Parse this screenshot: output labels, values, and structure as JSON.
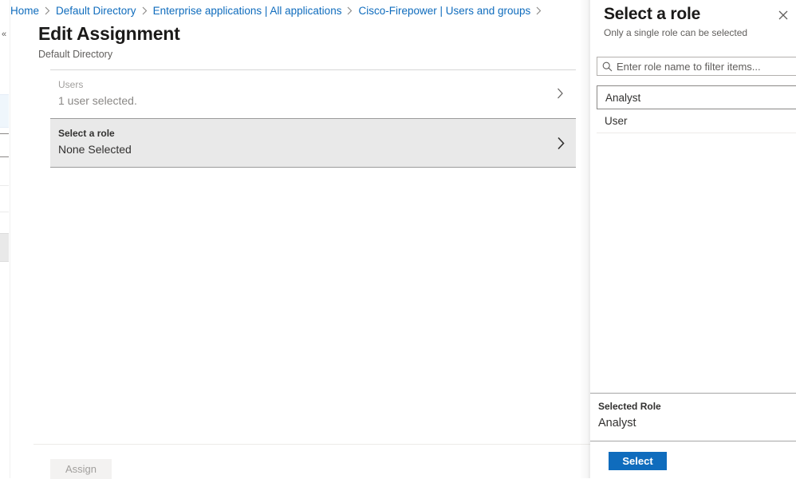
{
  "breadcrumb": {
    "items": [
      {
        "label": "Home"
      },
      {
        "label": "Default Directory"
      },
      {
        "label": "Enterprise applications | All applications"
      },
      {
        "label": "Cisco-Firepower | Users and groups"
      }
    ]
  },
  "blade": {
    "title": "Edit Assignment",
    "subtitle": "Default Directory",
    "fields": [
      {
        "label": "Users",
        "value": "1 user selected.",
        "icon": "chevron-right-icon"
      },
      {
        "label": "Select a role",
        "value": "None Selected",
        "icon": "chevron-right-icon"
      }
    ],
    "assign_label": "Assign"
  },
  "flyout": {
    "title": "Select a role",
    "subtitle": "Only a single role can be selected",
    "close_icon": "close-icon",
    "filter": {
      "icon": "search-icon",
      "value": "",
      "placeholder": "Enter role name to filter items..."
    },
    "roles": [
      {
        "label": "Analyst",
        "selected": true
      },
      {
        "label": "User",
        "selected": false
      }
    ],
    "selected_role_label": "Selected Role",
    "selected_role_value": "Analyst",
    "select_button_label": "Select"
  },
  "colors": {
    "accent": "#0f6cbd",
    "link": "#0f6cbd",
    "selected_row_bg": "#e9e9e9",
    "disabled_button_bg": "#f3f2f1",
    "disabled_button_text": "#a19f9d"
  }
}
